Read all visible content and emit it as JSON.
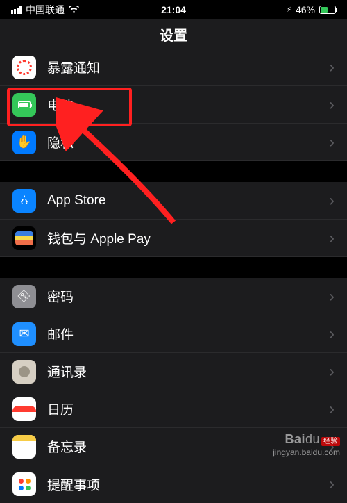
{
  "status": {
    "carrier": "中国联通",
    "time": "21:04",
    "battery_percent": "46%"
  },
  "header": {
    "title": "设置"
  },
  "groups": [
    {
      "items": [
        {
          "id": "exposure",
          "label": "暴露通知"
        },
        {
          "id": "battery",
          "label": "电池"
        },
        {
          "id": "privacy",
          "label": "隐私"
        }
      ]
    },
    {
      "items": [
        {
          "id": "appstore",
          "label": "App Store"
        },
        {
          "id": "wallet",
          "label": "钱包与 Apple Pay"
        }
      ]
    },
    {
      "items": [
        {
          "id": "passwords",
          "label": "密码"
        },
        {
          "id": "mail",
          "label": "邮件"
        },
        {
          "id": "contacts",
          "label": "通讯录"
        },
        {
          "id": "calendar",
          "label": "日历"
        },
        {
          "id": "notes",
          "label": "备忘录"
        },
        {
          "id": "reminders",
          "label": "提醒事项"
        }
      ]
    }
  ],
  "watermark": {
    "brand1": "Bai",
    "brand2": "du",
    "tag": "经验",
    "url": "jingyan.baidu.com"
  }
}
